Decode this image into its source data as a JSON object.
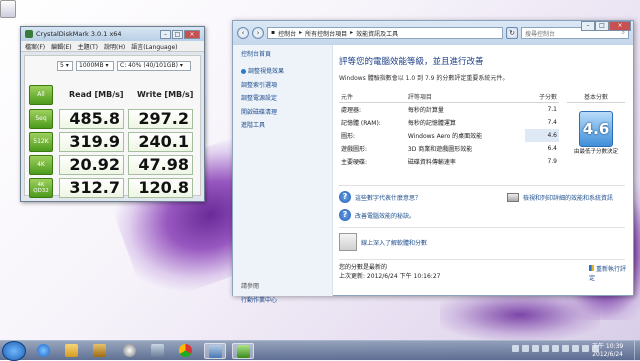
{
  "cdm": {
    "title": "CrystalDiskMark 3.0.1 x64",
    "menu": [
      "檔案(F)",
      "編輯(E)",
      "主題(T)",
      "說明(H)",
      "語言(Language)"
    ],
    "runs": "5",
    "size": "1000MB",
    "drive": "C: 40% (40/101GB)",
    "all_label": "All",
    "read_header": "Read [MB/s]",
    "write_header": "Write [MB/s]",
    "rows": [
      {
        "label": "Seq",
        "read": "485.8",
        "write": "297.2"
      },
      {
        "label": "512K",
        "read": "319.9",
        "write": "240.1"
      },
      {
        "label": "4K",
        "read": "20.92",
        "write": "47.98"
      },
      {
        "label": "4K QD32",
        "read": "312.7",
        "write": "120.8"
      }
    ],
    "colors": {
      "button_green": "#4c9a1c",
      "cell_border": "#a6bda0"
    }
  },
  "explorer": {
    "address": [
      "控制台",
      "所有控制台項目",
      "效能資訊及工具"
    ],
    "search_placeholder": "搜尋控制台",
    "sidebar": {
      "home": "控制台首頁",
      "links": [
        "調整視覺效果",
        "調整索引選項",
        "調整電源設定",
        "開啟磁碟清理",
        "進階工具"
      ],
      "see_also": "請參閱",
      "see_also_link": "行動作業中心"
    },
    "heading": "評等您的電腦效能等級，並且進行改善",
    "subhead": "Windows 體驗指數會以 1.0 到 7.9 的分數評定重要系統元件。",
    "table": {
      "headers": [
        "元件",
        "評等項目",
        "子分數",
        "基本分數"
      ],
      "rows": [
        {
          "component": "處理器:",
          "item": "每秒的計算量",
          "score": "7.1",
          "low": false
        },
        {
          "component": "記憶體 (RAM):",
          "item": "每秒的記憶體運算",
          "score": "7.4",
          "low": false
        },
        {
          "component": "圖形:",
          "item": "Windows Aero 的桌面效能",
          "score": "4.6",
          "low": true
        },
        {
          "component": "遊戲圖形:",
          "item": "3D 商業和遊戲圖形效能",
          "score": "6.4",
          "low": false
        },
        {
          "component": "主要硬碟:",
          "item": "磁碟資料傳輸速率",
          "score": "7.9",
          "low": false
        }
      ]
    },
    "base_score": "4.6",
    "base_caption": "由最低子分數決定",
    "links": {
      "what_mean": "這些數字代表什麼意思？",
      "improve": "改善電腦效能的秘訣。",
      "print": "檢視和列印詳細的效能和系統資訊",
      "learn_more": "線上深入了解軟體和分數"
    },
    "footer": {
      "status": "您的分數是最新的",
      "updated": "上次更新: 2012/6/24 下午 10:16:27",
      "refresh": "重新執行評定"
    }
  },
  "taskbar": {
    "time": "下午 10:39",
    "date": "2012/6/24"
  }
}
